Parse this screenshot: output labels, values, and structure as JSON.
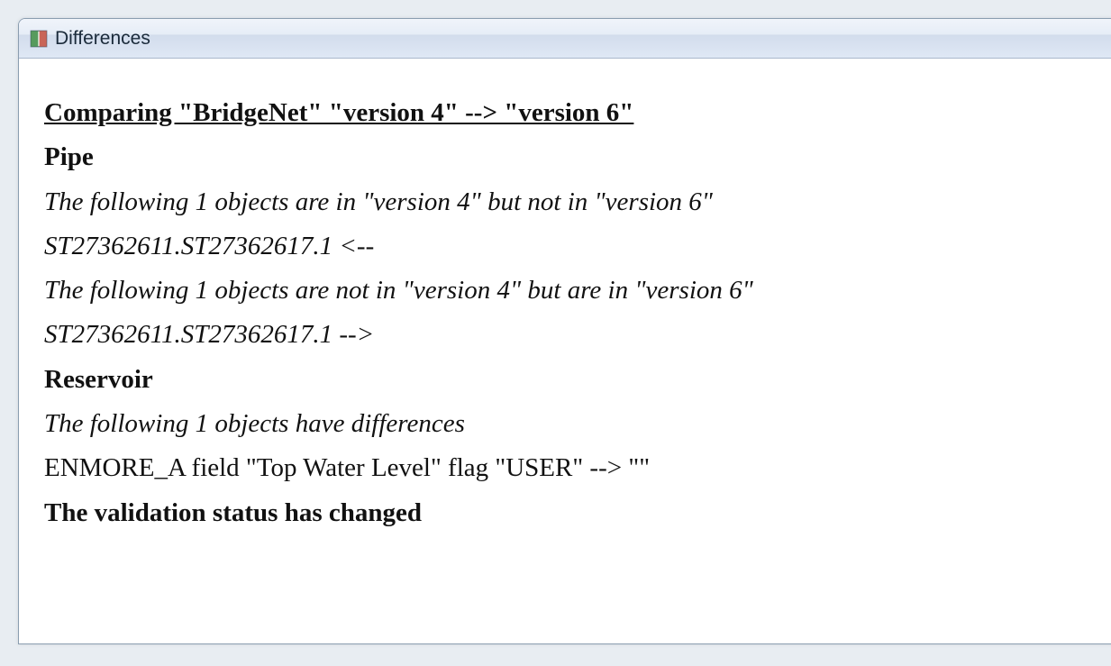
{
  "window": {
    "title": "Differences"
  },
  "report": {
    "heading": "Comparing \"BridgeNet\" \"version 4\" --> \"version 6\"",
    "section1_title": "Pipe",
    "section1_line1": "The following 1 objects are in \"version 4\" but not in \"version 6\"",
    "section1_line2": "ST27362611.ST27362617.1 <--",
    "section1_line3": "The following 1 objects are not in \"version 4\" but are in \"version 6\"",
    "section1_line4": "ST27362611.ST27362617.1 -->",
    "section2_title": "Reservoir",
    "section2_line1": "The following 1 objects have differences",
    "section2_line2": "ENMORE_A field \"Top Water Level\" flag \"USER\" --> \"\"",
    "footer": "The validation status has changed"
  }
}
